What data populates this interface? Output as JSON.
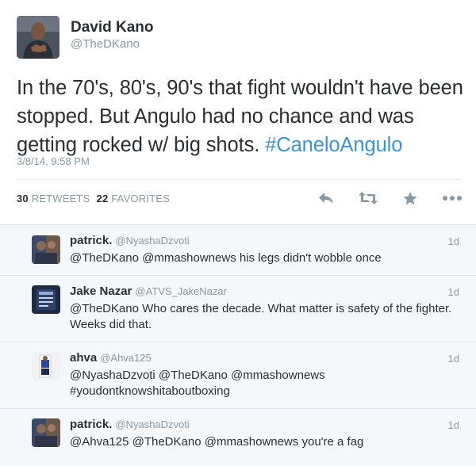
{
  "tweet": {
    "author_name": "David Kano",
    "author_handle": "@TheDKano",
    "text": "In the 70's, 80's, 90's that fight wouldn't have been stopped. But Angulo had no chance and was getting rocked w/ big shots.",
    "hashtag": "#CaneloAngulo",
    "timestamp": "3/8/14, 9:58 PM",
    "retweets_count": "30",
    "retweets_label": "RETWEETS",
    "favorites_count": "22",
    "favorites_label": "FAVORITES",
    "actions": [
      "reply-icon",
      "retweet-icon",
      "favorite-star-icon",
      "more-dots-icon"
    ]
  },
  "replies": [
    {
      "name": "patrick.",
      "handle": "@NyashaDzvoti",
      "time": "1d",
      "text": "@TheDKano @mmashownews his legs didn't wobble once",
      "avatar_icon": "user-avatar"
    },
    {
      "name": "Jake Nazar",
      "handle": "@ATVS_JakeNazar",
      "time": "1d",
      "text": "@TheDKano Who cares the decade. What matter is safety of the fighter. Weeks did that.",
      "avatar_icon": "user-avatar"
    },
    {
      "name": "ahva",
      "handle": "@Ahva125",
      "time": "1d",
      "text": "@NyashaDzvoti @TheDKano @mmashownews #youdontknowshitaboutboxing",
      "avatar_icon": "user-avatar"
    },
    {
      "name": "patrick.",
      "handle": "@NyashaDzvoti",
      "time": "1d",
      "text": "@Ahva125 @TheDKano @mmashownews you're a fag",
      "avatar_icon": "user-avatar"
    }
  ],
  "colors": {
    "text": "#292f33",
    "muted": "#8899a6",
    "link": "#3b94d9",
    "reply_bg": "#f5f8fa",
    "border": "#e1e8ed"
  }
}
